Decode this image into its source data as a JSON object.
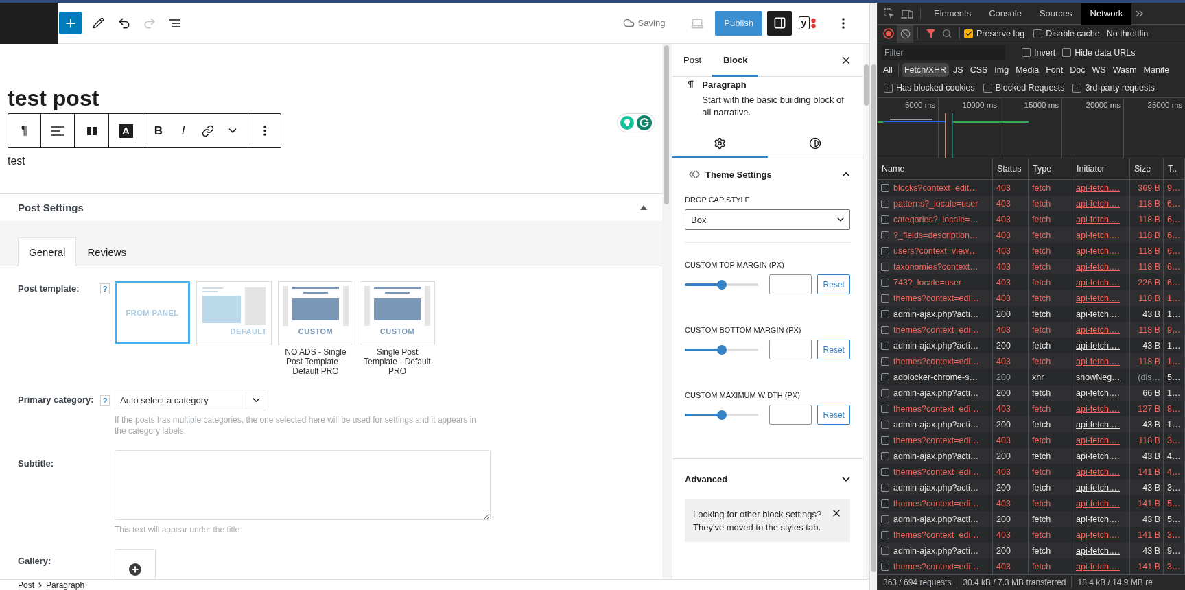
{
  "top_bar": {
    "status": "Saving",
    "publish": "Publish",
    "redo_disabled": true,
    "sidebar_open": true,
    "seo_glyph": "y"
  },
  "canvas": {
    "title": "test post",
    "paragraph": "test",
    "block_toolbar": {
      "paragraph_glyph": "¶",
      "highlight_glyph": "A",
      "bold": "B",
      "italic": "I"
    }
  },
  "meta_box": {
    "title": "Post Settings",
    "expanded": true,
    "tabs": [
      {
        "label": "General",
        "selected": true
      },
      {
        "label": "Reviews",
        "selected": false
      }
    ],
    "post_template": {
      "label": "Post template:",
      "help": "?",
      "templates": [
        {
          "kind": "panel",
          "badge": "FROM PANEL",
          "selected": true
        },
        {
          "kind": "default",
          "badge": "DEFAULT",
          "selected": false
        },
        {
          "kind": "custom",
          "badge": "CUSTOM",
          "caption": "NO ADS - Single Post Template – Default PRO",
          "selected": false
        },
        {
          "kind": "custom",
          "badge": "CUSTOM",
          "caption": "Single Post Template - Default PRO",
          "selected": false
        }
      ]
    },
    "primary_category": {
      "label": "Primary category:",
      "help": "?",
      "value": "Auto select a category",
      "hint": "If the posts has multiple categories, the one selected here will be used for settings and it appears in the category labels."
    },
    "subtitle": {
      "label": "Subtitle:",
      "hint": "This text will appear under the title"
    },
    "gallery": {
      "label": "Gallery:"
    }
  },
  "breadcrumb": [
    "Post",
    "Paragraph"
  ],
  "sidebar": {
    "tabs": [
      {
        "label": "Post",
        "selected": false
      },
      {
        "label": "Block",
        "selected": true
      }
    ],
    "block": {
      "name": "Paragraph",
      "description": "Start with the basic building block of all narrative."
    },
    "settings_tabs": [
      {
        "kind": "settings",
        "selected": true
      },
      {
        "kind": "styles",
        "selected": false
      }
    ],
    "theme_settings": {
      "title": "Theme Settings",
      "expanded": true,
      "drop_cap": {
        "label": "DROP CAP STYLE",
        "value": "Box"
      },
      "sliders": [
        {
          "label": "CUSTOM TOP MARGIN (PX)",
          "level": 0.5,
          "reset": "Reset"
        },
        {
          "label": "CUSTOM BOTTOM MARGIN (PX)",
          "level": 0.5,
          "reset": "Reset"
        },
        {
          "label": "CUSTOM MAXIMUM WIDTH (PX)",
          "level": 0.5,
          "reset": "Reset"
        }
      ]
    },
    "advanced": {
      "title": "Advanced",
      "expanded": false
    },
    "notice": "Looking for other block settings? They've moved to the styles tab."
  },
  "devtools": {
    "tabs": [
      {
        "label": "Elements",
        "selected": false
      },
      {
        "label": "Console",
        "selected": false
      },
      {
        "label": "Sources",
        "selected": false
      },
      {
        "label": "Network",
        "selected": true
      }
    ],
    "recording": true,
    "preserve_log": {
      "label": "Preserve log",
      "checked": true
    },
    "disable_cache": {
      "label": "Disable cache",
      "checked": false
    },
    "throttling": "No throttlin",
    "filter": {
      "placeholder": "Filter"
    },
    "invert": {
      "label": "Invert",
      "checked": false
    },
    "hide_data_urls": {
      "label": "Hide data URLs",
      "checked": false
    },
    "type_filters": [
      {
        "label": "All",
        "selected": false
      },
      {
        "label": "Fetch/XHR",
        "selected": true
      },
      {
        "label": "JS",
        "selected": false
      },
      {
        "label": "CSS",
        "selected": false
      },
      {
        "label": "Img",
        "selected": false
      },
      {
        "label": "Media",
        "selected": false
      },
      {
        "label": "Font",
        "selected": false
      },
      {
        "label": "Doc",
        "selected": false
      },
      {
        "label": "WS",
        "selected": false
      },
      {
        "label": "Wasm",
        "selected": false
      },
      {
        "label": "Manife",
        "selected": false
      }
    ],
    "request_filters": [
      {
        "label": "Has blocked cookies",
        "checked": false
      },
      {
        "label": "Blocked Requests",
        "checked": false
      },
      {
        "label": "3rd-party requests",
        "checked": false
      }
    ],
    "timeline": {
      "ticks": [
        "5000 ms",
        "10000 ms",
        "15000 ms",
        "20000 ms",
        "25000 ms"
      ]
    },
    "columns": [
      "Name",
      "Status",
      "Type",
      "Initiator",
      "Size",
      "T.."
    ],
    "rows": [
      {
        "kind": "error",
        "name": "blocks?context=edit…",
        "status": "403",
        "type": "fetch",
        "initiator": "api-fetch.…",
        "size": "369 B",
        "time": "9…"
      },
      {
        "kind": "error",
        "name": "patterns?_locale=user",
        "status": "403",
        "type": "fetch",
        "initiator": "api-fetch.…",
        "size": "118 B",
        "time": "6…"
      },
      {
        "kind": "error",
        "name": "categories?_locale=…",
        "status": "403",
        "type": "fetch",
        "initiator": "api-fetch.…",
        "size": "118 B",
        "time": "6…"
      },
      {
        "kind": "error",
        "name": "?_fields=description…",
        "status": "403",
        "type": "fetch",
        "initiator": "api-fetch.…",
        "size": "118 B",
        "time": "6…"
      },
      {
        "kind": "error",
        "name": "users?context=view…",
        "status": "403",
        "type": "fetch",
        "initiator": "api-fetch.…",
        "size": "118 B",
        "time": "6…"
      },
      {
        "kind": "error",
        "name": "taxonomies?context…",
        "status": "403",
        "type": "fetch",
        "initiator": "api-fetch.…",
        "size": "118 B",
        "time": "6…"
      },
      {
        "kind": "error",
        "name": "743?_locale=user",
        "status": "403",
        "type": "fetch",
        "initiator": "api-fetch.…",
        "size": "226 B",
        "time": "6…"
      },
      {
        "kind": "error",
        "name": "themes?context=edi…",
        "status": "403",
        "type": "fetch",
        "initiator": "api-fetch.…",
        "size": "118 B",
        "time": "1…"
      },
      {
        "kind": "ok",
        "name": "admin-ajax.php?acti…",
        "status": "200",
        "type": "fetch",
        "initiator": "api-fetch.…",
        "size": "43 B",
        "time": "1…"
      },
      {
        "kind": "error",
        "name": "themes?context=edi…",
        "status": "403",
        "type": "fetch",
        "initiator": "api-fetch.…",
        "size": "118 B",
        "time": "9…"
      },
      {
        "kind": "ok",
        "name": "admin-ajax.php?acti…",
        "status": "200",
        "type": "fetch",
        "initiator": "api-fetch.…",
        "size": "43 B",
        "time": "1…"
      },
      {
        "kind": "error",
        "name": "themes?context=edi…",
        "status": "403",
        "type": "fetch",
        "initiator": "api-fetch.…",
        "size": "118 B",
        "time": "1…"
      },
      {
        "kind": "cached",
        "name": "adblocker-chrome-s…",
        "status": "200",
        "type": "xhr",
        "initiator": "showNeg…",
        "size": "(dis…",
        "time": "5…"
      },
      {
        "kind": "ok",
        "name": "admin-ajax.php?acti…",
        "status": "200",
        "type": "fetch",
        "initiator": "api-fetch.…",
        "size": "66 B",
        "time": "1…"
      },
      {
        "kind": "error",
        "name": "themes?context=edi…",
        "status": "403",
        "type": "fetch",
        "initiator": "api-fetch.…",
        "size": "127 B",
        "time": "8…"
      },
      {
        "kind": "ok",
        "name": "admin-ajax.php?acti…",
        "status": "200",
        "type": "fetch",
        "initiator": "api-fetch.…",
        "size": "43 B",
        "time": "1…"
      },
      {
        "kind": "error",
        "name": "themes?context=edi…",
        "status": "403",
        "type": "fetch",
        "initiator": "api-fetch.…",
        "size": "118 B",
        "time": "3…"
      },
      {
        "kind": "ok",
        "name": "admin-ajax.php?acti…",
        "status": "200",
        "type": "fetch",
        "initiator": "api-fetch.…",
        "size": "43 B",
        "time": "4…"
      },
      {
        "kind": "error",
        "name": "themes?context=edi…",
        "status": "403",
        "type": "fetch",
        "initiator": "api-fetch.…",
        "size": "141 B",
        "time": "4…"
      },
      {
        "kind": "ok",
        "name": "admin-ajax.php?acti…",
        "status": "200",
        "type": "fetch",
        "initiator": "api-fetch.…",
        "size": "43 B",
        "time": "3…"
      },
      {
        "kind": "error",
        "name": "themes?context=edi…",
        "status": "403",
        "type": "fetch",
        "initiator": "api-fetch.…",
        "size": "141 B",
        "time": "5…"
      },
      {
        "kind": "ok",
        "name": "admin-ajax.php?acti…",
        "status": "200",
        "type": "fetch",
        "initiator": "api-fetch.…",
        "size": "43 B",
        "time": "5…"
      },
      {
        "kind": "error",
        "name": "themes?context=edi…",
        "status": "403",
        "type": "fetch",
        "initiator": "api-fetch.…",
        "size": "141 B",
        "time": "3…"
      },
      {
        "kind": "ok",
        "name": "admin-ajax.php?acti…",
        "status": "200",
        "type": "fetch",
        "initiator": "api-fetch.…",
        "size": "43 B",
        "time": "9…"
      },
      {
        "kind": "error",
        "name": "themes?context=edi…",
        "status": "403",
        "type": "fetch",
        "initiator": "api-fetch.…",
        "size": "141 B",
        "time": "3…"
      }
    ],
    "status_bar": [
      "363 / 694 requests",
      "30.4 kB / 7.3 MB transferred",
      "18.4 kB / 14.9 MB re"
    ]
  }
}
